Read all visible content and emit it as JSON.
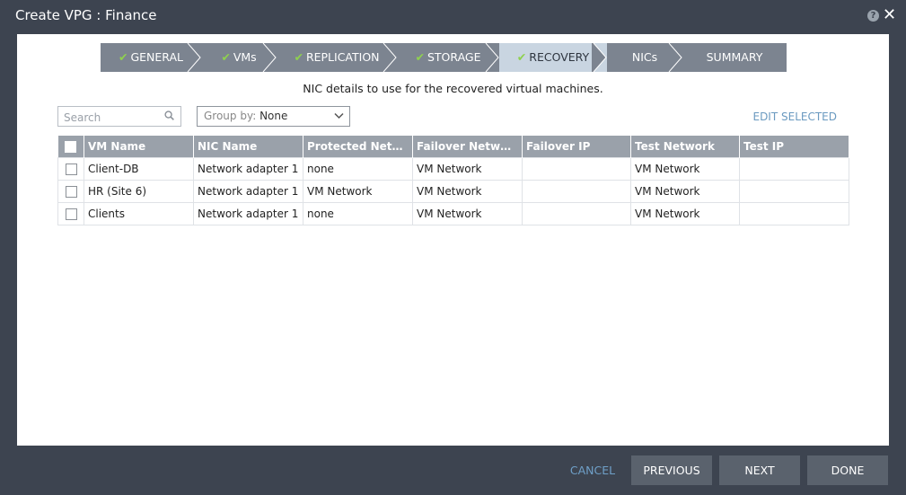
{
  "window": {
    "title": "Create VPG : Finance",
    "help_glyph": "?",
    "close_glyph": "✕"
  },
  "steps": [
    {
      "label": "GENERAL",
      "done": true
    },
    {
      "label": "VMs",
      "done": true
    },
    {
      "label": "REPLICATION",
      "done": true
    },
    {
      "label": "STORAGE",
      "done": true
    },
    {
      "label": "RECOVERY",
      "done": true,
      "active": true
    },
    {
      "label": "NICs",
      "done": false
    },
    {
      "label": "SUMMARY",
      "done": false
    }
  ],
  "check_glyph": "✔",
  "subtitle": "NIC details to use for the recovered virtual machines.",
  "search": {
    "placeholder": "Search"
  },
  "group_by": {
    "label": "Group by:",
    "value": "None"
  },
  "edit_selected": "EDIT SELECTED",
  "table": {
    "columns": [
      "VM Name",
      "NIC Name",
      "Protected Netw…",
      "Failover Network",
      "Failover IP",
      "Test Network",
      "Test IP"
    ],
    "rows": [
      [
        "Client-DB",
        "Network adapter 1",
        "none",
        "VM Network",
        "",
        "VM Network",
        ""
      ],
      [
        "HR (Site 6)",
        "Network adapter 1",
        "VM Network",
        "VM Network",
        "",
        "VM Network",
        ""
      ],
      [
        "Clients",
        "Network adapter 1",
        "none",
        "VM Network",
        "",
        "VM Network",
        ""
      ]
    ]
  },
  "footer": {
    "cancel": "CANCEL",
    "previous": "PREVIOUS",
    "next": "NEXT",
    "done": "DONE"
  },
  "colors": {
    "background": "#3d4450",
    "accent": "#6b9ac0",
    "step_active": "#c9d5e1",
    "step": "#7c8490",
    "check": "#8fd14f"
  }
}
